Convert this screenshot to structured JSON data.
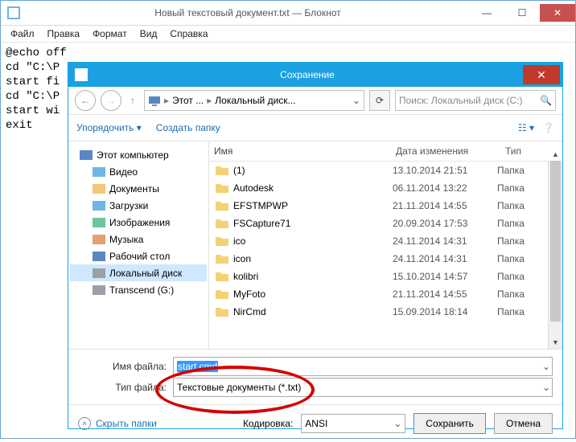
{
  "notepad": {
    "title": "Новый текстовый документ.txt — Блокнот",
    "menu": {
      "file": "Файл",
      "edit": "Правка",
      "format": "Формат",
      "view": "Вид",
      "help": "Справка"
    },
    "content": "@echo off\ncd \"C:\\P\nstart fi\ncd \"C:\\P\nstart wi\nexit"
  },
  "dialog": {
    "title": "Сохранение",
    "nav": {
      "this_pc": "Этот ...",
      "drive": "Локальный диск..."
    },
    "search_placeholder": "Поиск: Локальный диск (C:)",
    "toolbar": {
      "organize": "Упорядочить",
      "newfolder": "Создать папку"
    },
    "tree": [
      {
        "label": "Этот компьютер",
        "icon": "#5a86c4",
        "ind": false
      },
      {
        "label": "Видео",
        "icon": "#6eb6e6",
        "ind": true
      },
      {
        "label": "Документы",
        "icon": "#f0c87a",
        "ind": true
      },
      {
        "label": "Загрузки",
        "icon": "#6eb6e6",
        "ind": true
      },
      {
        "label": "Изображения",
        "icon": "#6ec4a0",
        "ind": true
      },
      {
        "label": "Музыка",
        "icon": "#e6a06e",
        "ind": true
      },
      {
        "label": "Рабочий стол",
        "icon": "#5a86c4",
        "ind": true
      },
      {
        "label": "Локальный диск",
        "icon": "#9aa0a6",
        "ind": true,
        "sel": true
      },
      {
        "label": "Transcend (G:)",
        "icon": "#9aa0a6",
        "ind": true
      }
    ],
    "columns": {
      "name": "Имя",
      "date": "Дата изменения",
      "type": "Тип"
    },
    "rows": [
      {
        "name": "(1)",
        "date": "13.10.2014 21:51",
        "type": "Папка"
      },
      {
        "name": "Autodesk",
        "date": "06.11.2014 13:22",
        "type": "Папка"
      },
      {
        "name": "EFSTMPWP",
        "date": "21.11.2014 14:55",
        "type": "Папка"
      },
      {
        "name": "FSCapture71",
        "date": "20.09.2014 17:53",
        "type": "Папка"
      },
      {
        "name": "ico",
        "date": "24.11.2014 14:31",
        "type": "Папка"
      },
      {
        "name": "icon",
        "date": "24.11.2014 14:31",
        "type": "Папка"
      },
      {
        "name": "kolibri",
        "date": "15.10.2014 14:57",
        "type": "Папка"
      },
      {
        "name": "MyFoto",
        "date": "21.11.2014 14:55",
        "type": "Папка"
      },
      {
        "name": "NirCmd",
        "date": "15.09.2014 18:14",
        "type": "Папка"
      }
    ],
    "filename_label": "Имя файла:",
    "filetype_label": "Тип файла:",
    "filename_value": "start.cmd",
    "filetype_value": "Текстовые документы (*.txt)",
    "encoding_label": "Кодировка:",
    "encoding_value": "ANSI",
    "hide_folders": "Скрыть папки",
    "save": "Сохранить",
    "cancel": "Отмена"
  }
}
